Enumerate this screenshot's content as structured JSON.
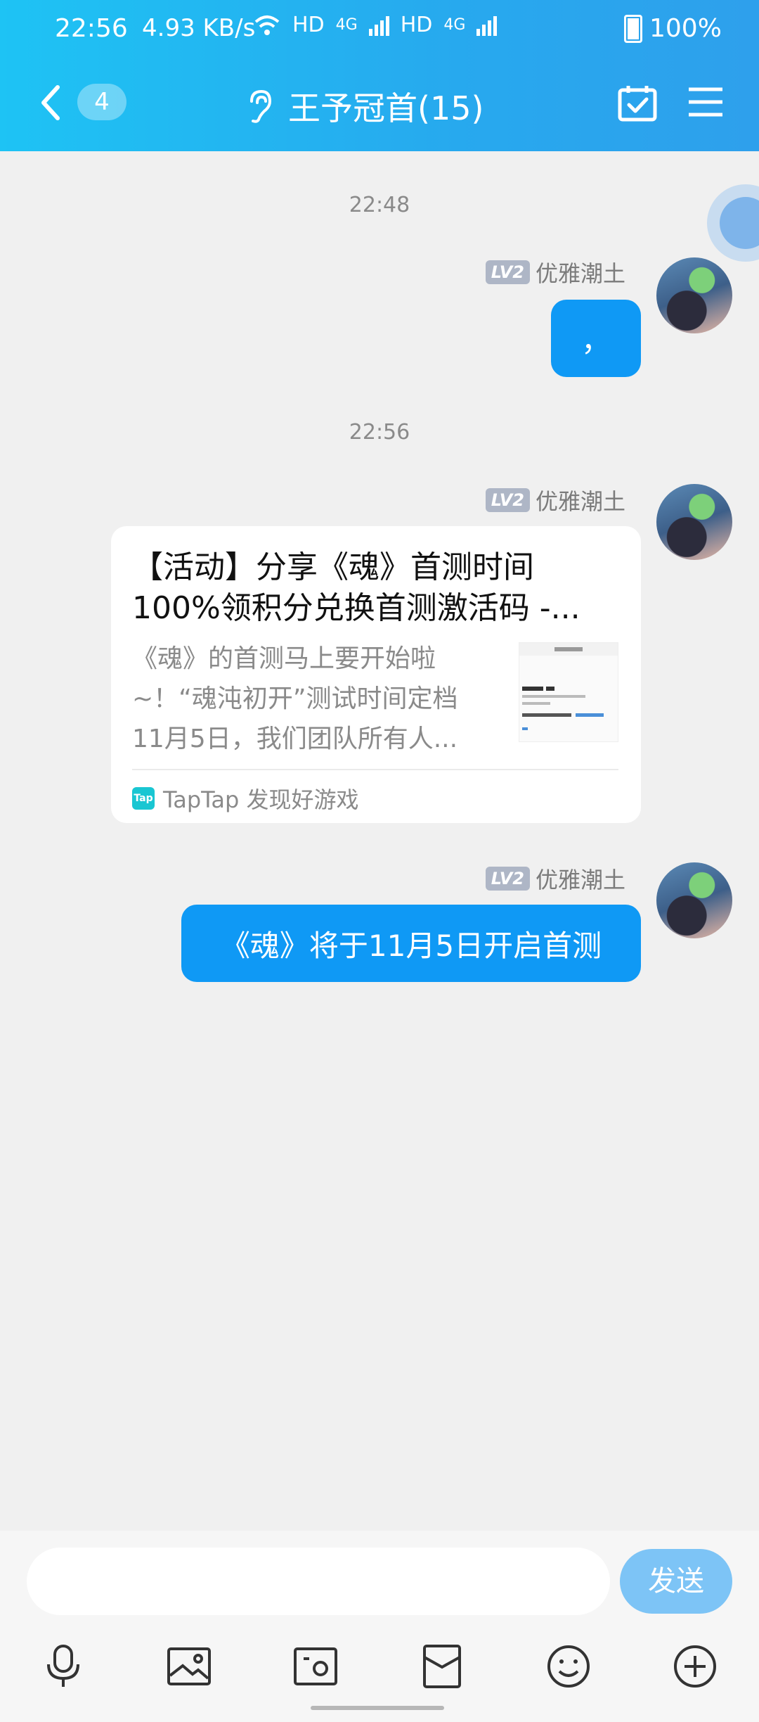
{
  "status_bar": {
    "time": "22:56",
    "speed": "4.93 KB/s",
    "battery": "100%",
    "hd1": "HD",
    "net1": "4G",
    "hd2": "HD",
    "net2": "4G"
  },
  "header": {
    "unread_count": "4",
    "title": "王予冠首(15)"
  },
  "messages": {
    "time1": "22:48",
    "time2": "22:56",
    "sender_name": "优雅潮土",
    "level": "LV2",
    "msg1_text": "，",
    "card_title": "【活动】分享《魂》首测时间100%领积分兑换首测激活码 -...",
    "card_desc": "《魂》的首测马上要开始啦~！“魂沌初开”测试时间定档11月5日，我们团队所有人...",
    "card_source": "TapTap 发现好游戏",
    "card_logo": "Tap",
    "msg3_text": "《魂》将于11月5日开启首测"
  },
  "input": {
    "placeholder": "",
    "send_label": "发送"
  },
  "colors": {
    "header_start": "#1ec3f4",
    "header_end": "#2ea0ec",
    "bubble": "#0f99f5",
    "send_button": "#7dc4f6"
  }
}
